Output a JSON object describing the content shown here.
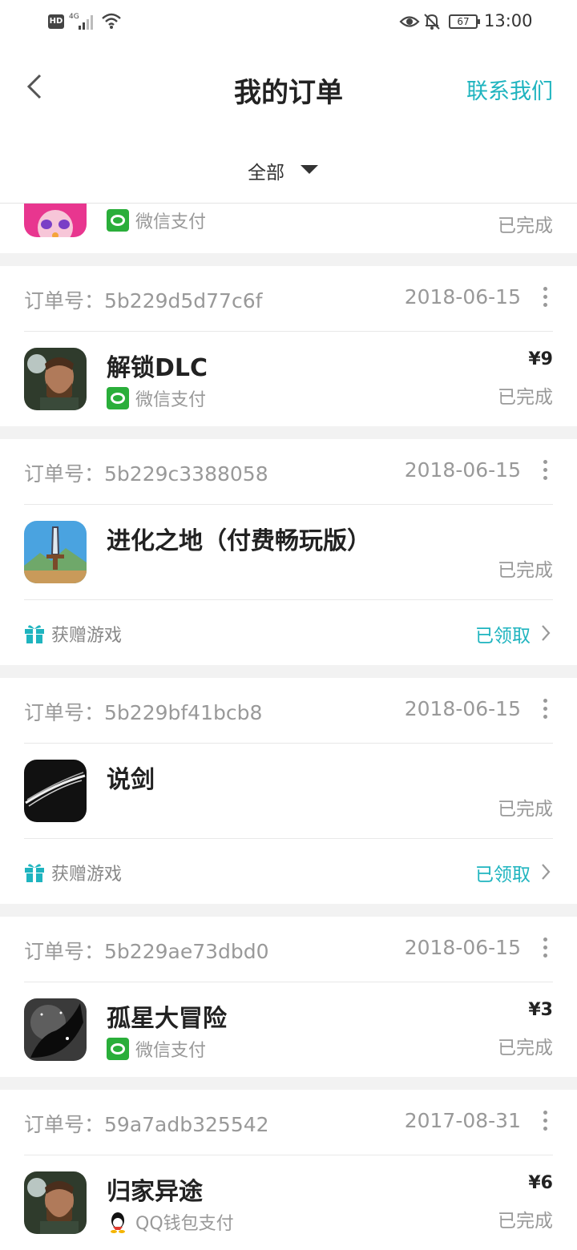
{
  "status_bar": {
    "hd": "HD",
    "network": "4G",
    "battery": "67",
    "time": "13:00"
  },
  "header": {
    "title": "我的订单",
    "contact": "联系我们"
  },
  "filter": {
    "label": "全部"
  },
  "partial_order": {
    "payment": "微信支付",
    "status": "已完成"
  },
  "orders": [
    {
      "label": "订单号：",
      "id": "5b229d5d77c6f",
      "date": "2018-06-15",
      "name": "解锁DLC",
      "price": "¥9",
      "payment": "微信支付",
      "status": "已完成"
    },
    {
      "label": "订单号：",
      "id": "5b229c3388058",
      "date": "2018-06-15",
      "name": "进化之地（付费畅玩版）",
      "status": "已完成",
      "gift_label": "获赠游戏",
      "gift_status": "已领取"
    },
    {
      "label": "订单号：",
      "id": "5b229bf41bcb8",
      "date": "2018-06-15",
      "name": "说剑",
      "status": "已完成",
      "gift_label": "获赠游戏",
      "gift_status": "已领取"
    },
    {
      "label": "订单号：",
      "id": "5b229ae73dbd0",
      "date": "2018-06-15",
      "name": "孤星大冒险",
      "price": "¥3",
      "payment": "微信支付",
      "status": "已完成"
    },
    {
      "label": "订单号：",
      "id": "59a7adb325542",
      "date": "2017-08-31",
      "name": "归家异途",
      "price": "¥6",
      "payment": "QQ钱包支付",
      "status": "已完成"
    }
  ],
  "colors": {
    "accent": "#1fb4bf",
    "wechat": "#2aae3a",
    "muted": "#999999"
  }
}
